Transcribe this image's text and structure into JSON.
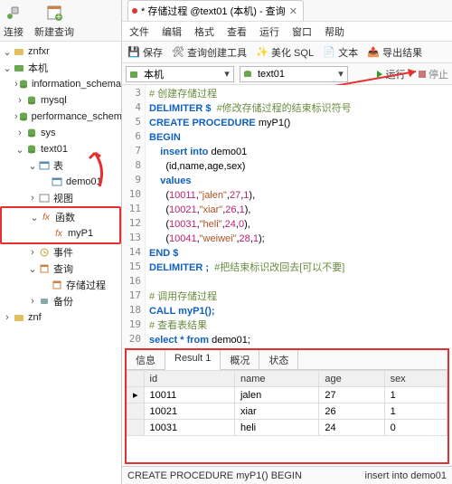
{
  "sidebar": {
    "tools": {
      "connect": "连接",
      "newQuery": "新建查询"
    },
    "items": [
      {
        "lvl": 0,
        "tw": "v",
        "ic": "db-y",
        "label": "znfxr"
      },
      {
        "lvl": 0,
        "tw": "v",
        "ic": "db-g",
        "label": "本机"
      },
      {
        "lvl": 1,
        "tw": ">",
        "ic": "sch",
        "label": "information_schema"
      },
      {
        "lvl": 1,
        "tw": ">",
        "ic": "sch",
        "label": "mysql"
      },
      {
        "lvl": 1,
        "tw": ">",
        "ic": "sch",
        "label": "performance_schema"
      },
      {
        "lvl": 1,
        "tw": ">",
        "ic": "sch",
        "label": "sys"
      },
      {
        "lvl": 1,
        "tw": "v",
        "ic": "sch",
        "label": "text01"
      },
      {
        "lvl": 2,
        "tw": "v",
        "ic": "tbl",
        "label": "表"
      },
      {
        "lvl": 3,
        "tw": "",
        "ic": "tbl",
        "label": "demo01"
      },
      {
        "lvl": 2,
        "tw": ">",
        "ic": "view",
        "label": "视图"
      }
    ],
    "funcBox": [
      {
        "lvl": 2,
        "tw": "v",
        "ic": "fx",
        "label": "函数"
      },
      {
        "lvl": 3,
        "tw": "",
        "ic": "fx",
        "label": "myP1"
      }
    ],
    "items2": [
      {
        "lvl": 2,
        "tw": ">",
        "ic": "evt",
        "label": "事件"
      },
      {
        "lvl": 2,
        "tw": "v",
        "ic": "qry",
        "label": "查询"
      },
      {
        "lvl": 3,
        "tw": "",
        "ic": "qry",
        "label": "存储过程"
      },
      {
        "lvl": 2,
        "tw": ">",
        "ic": "bak",
        "label": "备份"
      },
      {
        "lvl": 0,
        "tw": ">",
        "ic": "db-y",
        "label": "znf"
      }
    ]
  },
  "tab": {
    "title": "* 存储过程 @text01 (本机) - 查询"
  },
  "menu": [
    "文件",
    "编辑",
    "格式",
    "查看",
    "运行",
    "窗口",
    "帮助"
  ],
  "toolbar": {
    "save": "保存",
    "queryBuilder": "查询创建工具",
    "beautify": "美化 SQL",
    "text": "文本",
    "export": "导出结果"
  },
  "conns": {
    "left": "本机",
    "right": "text01",
    "run": "运行",
    "stop": "停止"
  },
  "code": {
    "lines": [
      3,
      4,
      5,
      6,
      7,
      8,
      9,
      10,
      11,
      12,
      13,
      14,
      15,
      16,
      17,
      18,
      19,
      20
    ],
    "l3": "# 创建存储过程",
    "l4a": "DELIMITER $  ",
    "l4b": "#修改存储过程的结束标识符号",
    "l5a": "CREATE PROCEDURE ",
    "l5b": "myP1()",
    "l6": "BEGIN",
    "l7a": "    insert into ",
    "l7b": "demo01",
    "l8": "      (id,name,age,sex)",
    "l9": "    values",
    "l10a": "      (",
    "l10b": "10011",
    "l10c": ",",
    "l10d": "\"jalen\"",
    "l10e": ",",
    "l10f": "27",
    "l10g": ",",
    "l10h": "1",
    "l10i": "),",
    "l11a": "      (",
    "l11b": "10021",
    "l11c": ",",
    "l11d": "\"xiar\"",
    "l11e": ",",
    "l11f": "26",
    "l11g": ",",
    "l11h": "1",
    "l11i": "),",
    "l12a": "      (",
    "l12b": "10031",
    "l12c": ",",
    "l12d": "\"heli\"",
    "l12e": ",",
    "l12f": "24",
    "l12g": ",",
    "l12h": "0",
    "l12i": "),",
    "l13a": "      (",
    "l13b": "10041",
    "l13c": ",",
    "l13d": "\"weiwei\"",
    "l13e": ",",
    "l13f": "28",
    "l13g": ",",
    "l13h": "1",
    "l13i": ");",
    "l14": "END $",
    "l15a": "DELIMITER ;  ",
    "l15b": "#把结束标识改回去[可以不要]",
    "l17": "# 调用存储过程",
    "l18": "CALL myP1();",
    "l19": "# 查看表结果",
    "l20a": "select * from ",
    "l20b": "demo01",
    ";": ";"
  },
  "results": {
    "tabs": [
      "信息",
      "Result 1",
      "概况",
      "状态"
    ],
    "cols": [
      "id",
      "name",
      "age",
      "sex"
    ],
    "rows": [
      {
        "id": "10011",
        "name": "jalen",
        "age": "27",
        "sex": "1",
        "mark": "▸"
      },
      {
        "id": "10021",
        "name": "xiar",
        "age": "26",
        "sex": "1",
        "mark": ""
      },
      {
        "id": "10031",
        "name": "heli",
        "age": "24",
        "sex": "0",
        "mark": ""
      }
    ]
  },
  "status": {
    "left": "CREATE PROCEDURE myP1() BEGIN",
    "right": "insert into demo01"
  }
}
